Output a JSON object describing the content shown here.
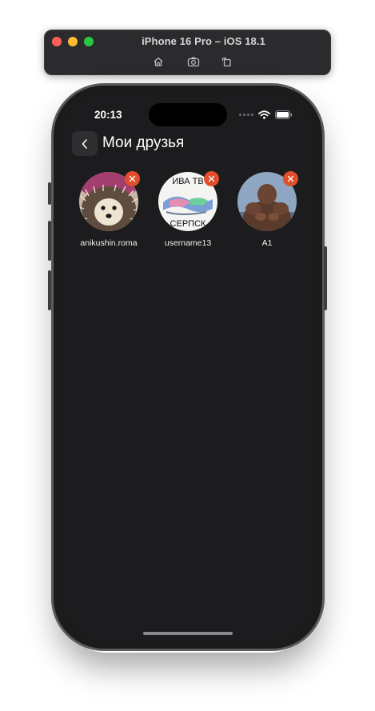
{
  "simulator": {
    "title": "iPhone 16 Pro – iOS 18.1",
    "buttons": [
      "home-icon",
      "screenshot-icon",
      "rotate-icon"
    ]
  },
  "status_bar": {
    "time": "20:13",
    "icons": [
      "cellular-icon",
      "wifi-icon",
      "battery-icon"
    ]
  },
  "header": {
    "back_icon": "chevron-left-icon",
    "title": "Мои друзья"
  },
  "friends": [
    {
      "name": "anikushin.roma",
      "avatar": "hedgehog photo"
    },
    {
      "name": "username13",
      "avatar": "meme picture",
      "avatar_text_top": "ИВА ТВ",
      "avatar_text_bottom": "СЕРПСК"
    },
    {
      "name": "A1",
      "avatar": "man photo"
    }
  ],
  "colors": {
    "background": "#1c1c1e",
    "remove_badge": "#e14f2a",
    "back_button_bg": "#2e2e30"
  }
}
